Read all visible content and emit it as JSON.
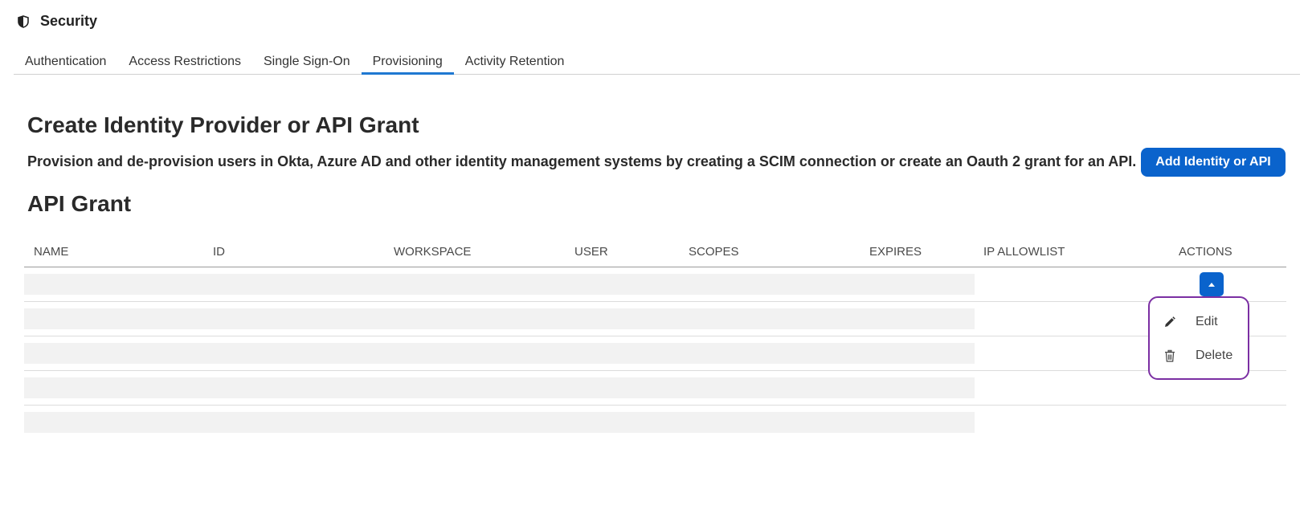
{
  "header": {
    "title": "Security",
    "icon": "shield-icon"
  },
  "tabs": [
    {
      "label": "Authentication",
      "active": false
    },
    {
      "label": "Access Restrictions",
      "active": false
    },
    {
      "label": "Single Sign-On",
      "active": false
    },
    {
      "label": "Provisioning",
      "active": true
    },
    {
      "label": "Activity Retention",
      "active": false
    }
  ],
  "main": {
    "heading": "Create Identity Provider or API Grant",
    "description": "Provision and de-provision users in Okta, Azure AD and other identity management systems by creating a SCIM connection or create an Oauth 2 grant for an API.",
    "add_button_label": "Add Identity or API",
    "section_heading": "API Grant"
  },
  "table": {
    "columns": [
      "NAME",
      "ID",
      "WORKSPACE",
      "USER",
      "SCOPES",
      "EXPIRES",
      "IP ALLOWLIST",
      "ACTIONS"
    ],
    "row_count": 5,
    "rows_loading": true
  },
  "actions_menu": {
    "items": [
      {
        "label": "Edit",
        "icon": "pencil-icon"
      },
      {
        "label": "Delete",
        "icon": "trash-icon"
      }
    ]
  },
  "colors": {
    "accent": "#0a63cc",
    "tab_underline": "#1f78d1",
    "menu_border": "#7b2fa3",
    "skeleton": "#f2f2f2"
  }
}
